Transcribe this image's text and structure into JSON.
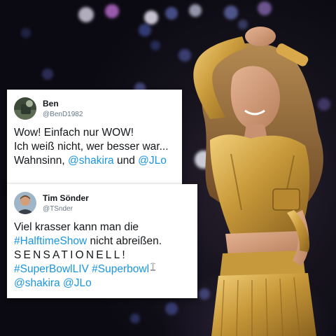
{
  "colors": {
    "link": "#1b95e0",
    "text": "#14171a",
    "handle": "#657786",
    "card": "#ffffff",
    "gold": "#c99a3a"
  },
  "tweets": [
    {
      "name": "Ben",
      "handle": "@BenD1982",
      "avatar_icon": "avatar-photo",
      "lines": [
        [
          {
            "text": "Wow! Einfach nur WOW!",
            "link": false
          }
        ],
        [
          {
            "text": "Ich weiß nicht, wer besser war...",
            "link": false
          }
        ],
        [
          {
            "text": "Wahnsinn, ",
            "link": false
          },
          {
            "text": "@shakira",
            "link": true
          },
          {
            "text": " und ",
            "link": false
          },
          {
            "text": "@JLo",
            "link": true
          }
        ]
      ]
    },
    {
      "name": "Tim Sönder",
      "handle": "@TSnder",
      "avatar_icon": "avatar-photo",
      "lines": [
        [
          {
            "text": "Viel krasser kann man die",
            "link": false
          }
        ],
        [
          {
            "text": "#HalftimeShow",
            "link": true
          },
          {
            "text": " nicht abreißen.",
            "link": false
          }
        ],
        [
          {
            "text": "SENSATIONELL!",
            "link": false,
            "spaced": true
          }
        ],
        [
          {
            "text": "#SuperBowlLIV",
            "link": true
          },
          {
            "text": " ",
            "link": false
          },
          {
            "text": "#Superbowl",
            "link": true
          },
          {
            "icon": "super-bowl-liv-logo-icon"
          }
        ],
        [
          {
            "text": "@shakira",
            "link": true
          },
          {
            "text": " ",
            "link": false
          },
          {
            "text": "@JLo",
            "link": true
          }
        ]
      ]
    }
  ]
}
